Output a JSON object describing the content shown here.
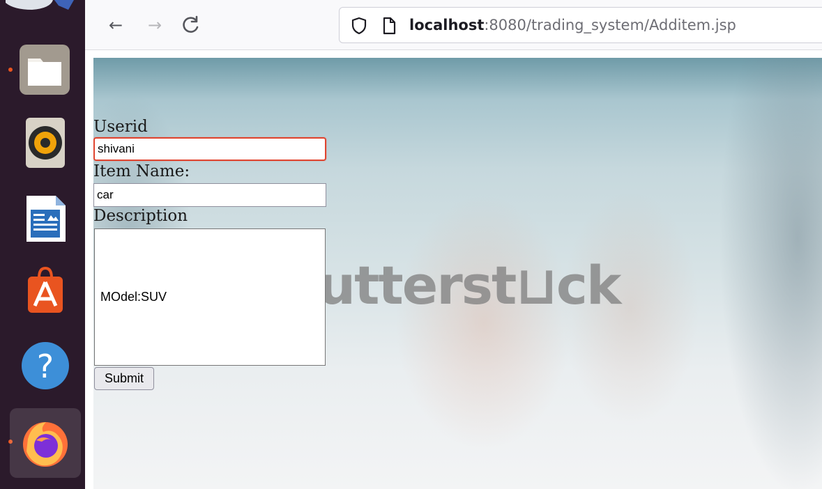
{
  "browser": {
    "back": "←",
    "forward": "→",
    "reload": "C",
    "url_host": "localhost",
    "url_path": ":8080/trading_system/Additem.jsp"
  },
  "page": {
    "watermark": "utterst⊔ck",
    "form": {
      "userid_label": "Userid",
      "userid_value": "shivani",
      "itemname_label": "Item Name:",
      "itemname_value": "car",
      "description_label": "Description",
      "description_value": "MOdel:SUV",
      "submit_label": "Submit"
    }
  },
  "colors": {
    "dock": "#2b1a2b",
    "focus_ring": "#e0442f",
    "ubuntu_orange": "#e95420"
  },
  "dock": {
    "apps": [
      "files-icon",
      "rhythmbox-icon",
      "libreoffice-writer-icon",
      "software-center-icon",
      "help-icon",
      "firefox-icon"
    ]
  }
}
